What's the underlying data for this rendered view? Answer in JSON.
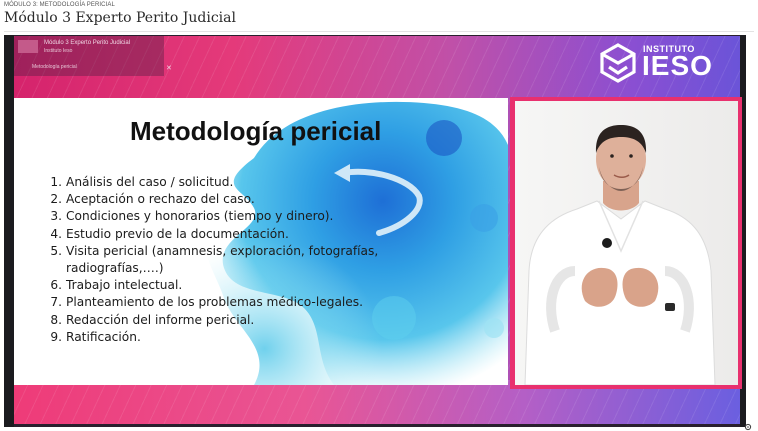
{
  "breadcrumb": "MÓDULO 3: METODOLOGÍA PERICIAL",
  "page_title": "Módulo 3 Experto Perito Judicial",
  "video": {
    "overlay": {
      "title": "Módulo 3 Experto Perito Judicial",
      "subtitle": "Instituto Ieso",
      "chapter": "Metodología pericial",
      "close_icon": "close-icon"
    },
    "logo": {
      "institute": "INSTITUTO",
      "brand": "IESO"
    },
    "slide": {
      "title": "Metodología pericial",
      "steps": [
        {
          "num": "1.",
          "text": "Análisis del caso / solicitud."
        },
        {
          "num": "2.",
          "text": "Aceptación o rechazo del caso."
        },
        {
          "num": "3.",
          "text": "Condiciones y honorarios (tiempo y dinero)."
        },
        {
          "num": "4.",
          "text": "Estudio previo de la documentación."
        },
        {
          "num": "5.",
          "text": "Visita pericial (anamnesis, exploración, fotografías,"
        },
        {
          "num": "",
          "text": "radiografías,….)"
        },
        {
          "num": "6.",
          "text": "Trabajo intelectual."
        },
        {
          "num": "7.",
          "text": "Planteamiento de los problemas médico-legales."
        },
        {
          "num": "8.",
          "text": "Redacción del informe pericial."
        },
        {
          "num": "9.",
          "text": "Ratificación."
        }
      ]
    },
    "colors": {
      "accent_pink": "#e8306e",
      "accent_violet": "#6a54d8",
      "splash_blue": "#2aa6e0"
    }
  },
  "settings_icon": "gear-icon"
}
